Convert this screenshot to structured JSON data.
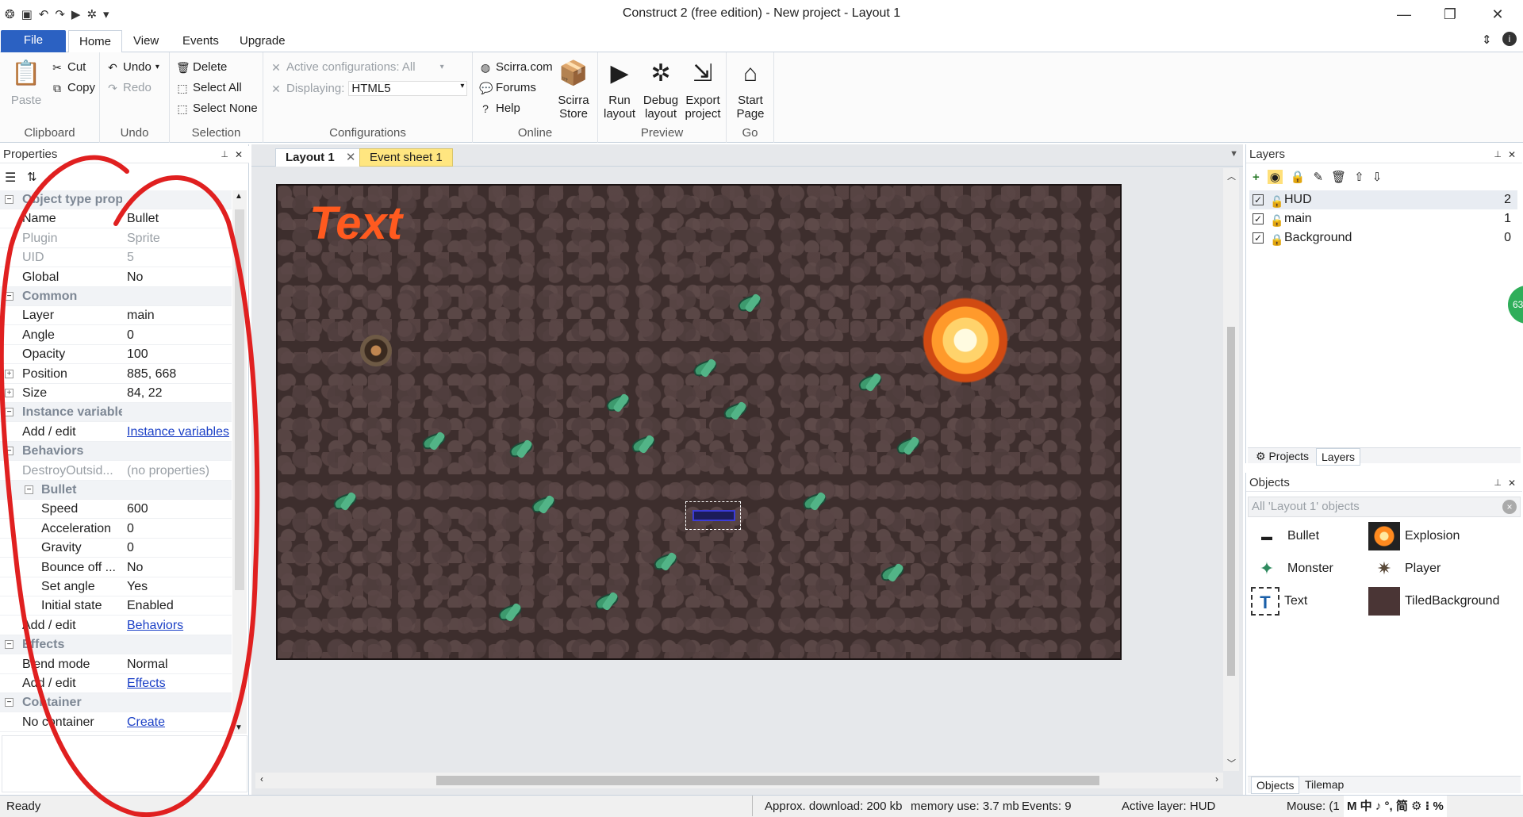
{
  "window": {
    "title": "Construct 2  (free edition) - New project - Layout 1"
  },
  "ribbon_tabs": [
    "File",
    "Home",
    "View",
    "Events",
    "Upgrade"
  ],
  "ribbon": {
    "clipboard": {
      "paste": "Paste",
      "cut": "Cut",
      "copy": "Copy",
      "label": "Clipboard"
    },
    "undo": {
      "undo": "Undo",
      "redo": "Redo",
      "label": "Undo"
    },
    "selection": {
      "delete": "Delete",
      "select_all": "Select All",
      "select_none": "Select None",
      "label": "Selection"
    },
    "configurations": {
      "active": "Active configurations: All",
      "displaying_label": "Displaying:",
      "displaying_value": "HTML5",
      "label": "Configurations"
    },
    "online": {
      "scirra": "Scirra.com",
      "forums": "Forums",
      "help": "Help",
      "store": "Scirra Store",
      "label": "Online"
    },
    "preview": {
      "run": "Run layout",
      "debug": "Debug layout",
      "export": "Export project",
      "label": "Preview"
    },
    "go": {
      "start": "Start Page",
      "label": "Go"
    }
  },
  "properties": {
    "title": "Properties",
    "rows": [
      {
        "type": "cat",
        "k": "Object type properties"
      },
      {
        "k": "Name",
        "v": "Bullet"
      },
      {
        "k": "Plugin",
        "v": "Sprite",
        "dim": true
      },
      {
        "k": "UID",
        "v": "5",
        "dim": true
      },
      {
        "k": "Global",
        "v": "No"
      },
      {
        "type": "cat",
        "k": "Common"
      },
      {
        "k": "Layer",
        "v": "main"
      },
      {
        "k": "Angle",
        "v": "0"
      },
      {
        "k": "Opacity",
        "v": "100"
      },
      {
        "k": "Position",
        "v": "885, 668",
        "exp": true
      },
      {
        "k": "Size",
        "v": "84, 22",
        "exp": true
      },
      {
        "type": "cat",
        "k": "Instance variables"
      },
      {
        "k": "Add / edit",
        "v": "Instance variables",
        "link": true
      },
      {
        "type": "cat",
        "k": "Behaviors"
      },
      {
        "k": "DestroyOutsid...",
        "v": "(no properties)",
        "dim": true
      },
      {
        "type": "subcat",
        "k": "Bullet"
      },
      {
        "k": "Speed",
        "v": "600",
        "sub": true
      },
      {
        "k": "Acceleration",
        "v": "0",
        "sub": true
      },
      {
        "k": "Gravity",
        "v": "0",
        "sub": true
      },
      {
        "k": "Bounce off ...",
        "v": "No",
        "sub": true
      },
      {
        "k": "Set angle",
        "v": "Yes",
        "sub": true
      },
      {
        "k": "Initial state",
        "v": "Enabled",
        "sub": true
      },
      {
        "k": "Add / edit",
        "v": "Behaviors",
        "link": true
      },
      {
        "type": "cat",
        "k": "Effects"
      },
      {
        "k": "Blend mode",
        "v": "Normal"
      },
      {
        "k": "Add / edit",
        "v": "Effects",
        "link": true
      },
      {
        "type": "cat",
        "k": "Container"
      },
      {
        "k": "No container",
        "v": "Create",
        "link": true
      }
    ]
  },
  "doc_tabs": {
    "layout": "Layout 1",
    "events": "Event sheet 1"
  },
  "canvas": {
    "text": "Text"
  },
  "layers": {
    "title": "Layers",
    "items": [
      {
        "name": "HUD",
        "num": "2"
      },
      {
        "name": "main",
        "num": "1"
      },
      {
        "name": "Background",
        "num": "0"
      }
    ],
    "tabs": [
      "Projects",
      "Layers"
    ]
  },
  "objects": {
    "title": "Objects",
    "filter": "All 'Layout 1' objects",
    "items": [
      "Bullet",
      "Explosion",
      "Monster",
      "Player",
      "Text",
      "TiledBackground"
    ],
    "tabs": [
      "Objects",
      "Tilemap"
    ]
  },
  "status": {
    "ready": "Ready",
    "download": "Approx. download: 200 kb",
    "memory": "memory use: 3.7 mb",
    "events": "Events: 9",
    "active_layer": "Active layer: HUD",
    "mouse": "Mouse: (1",
    "ime": "M 中 ♪ °, 简 ⚙ ⁝ %"
  },
  "badge": "63",
  "colors": {
    "file_tab": "#2b61c2",
    "text_object": "#ff5a1f",
    "annotation": "#e02020",
    "event_tab": "#ffe680"
  }
}
